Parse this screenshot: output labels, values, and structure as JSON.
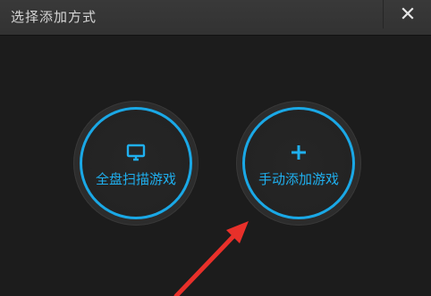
{
  "window": {
    "title": "选择添加方式"
  },
  "buttons": {
    "scan_label": "全盘扫描游戏",
    "manual_label": "手动添加游戏"
  },
  "icons": {
    "close": "close-icon",
    "monitor": "monitor-icon",
    "plus": "plus-icon",
    "arrow": "red-annotation-arrow"
  },
  "colors": {
    "accent": "#1aa8e6",
    "arrow": "#e8302a"
  }
}
